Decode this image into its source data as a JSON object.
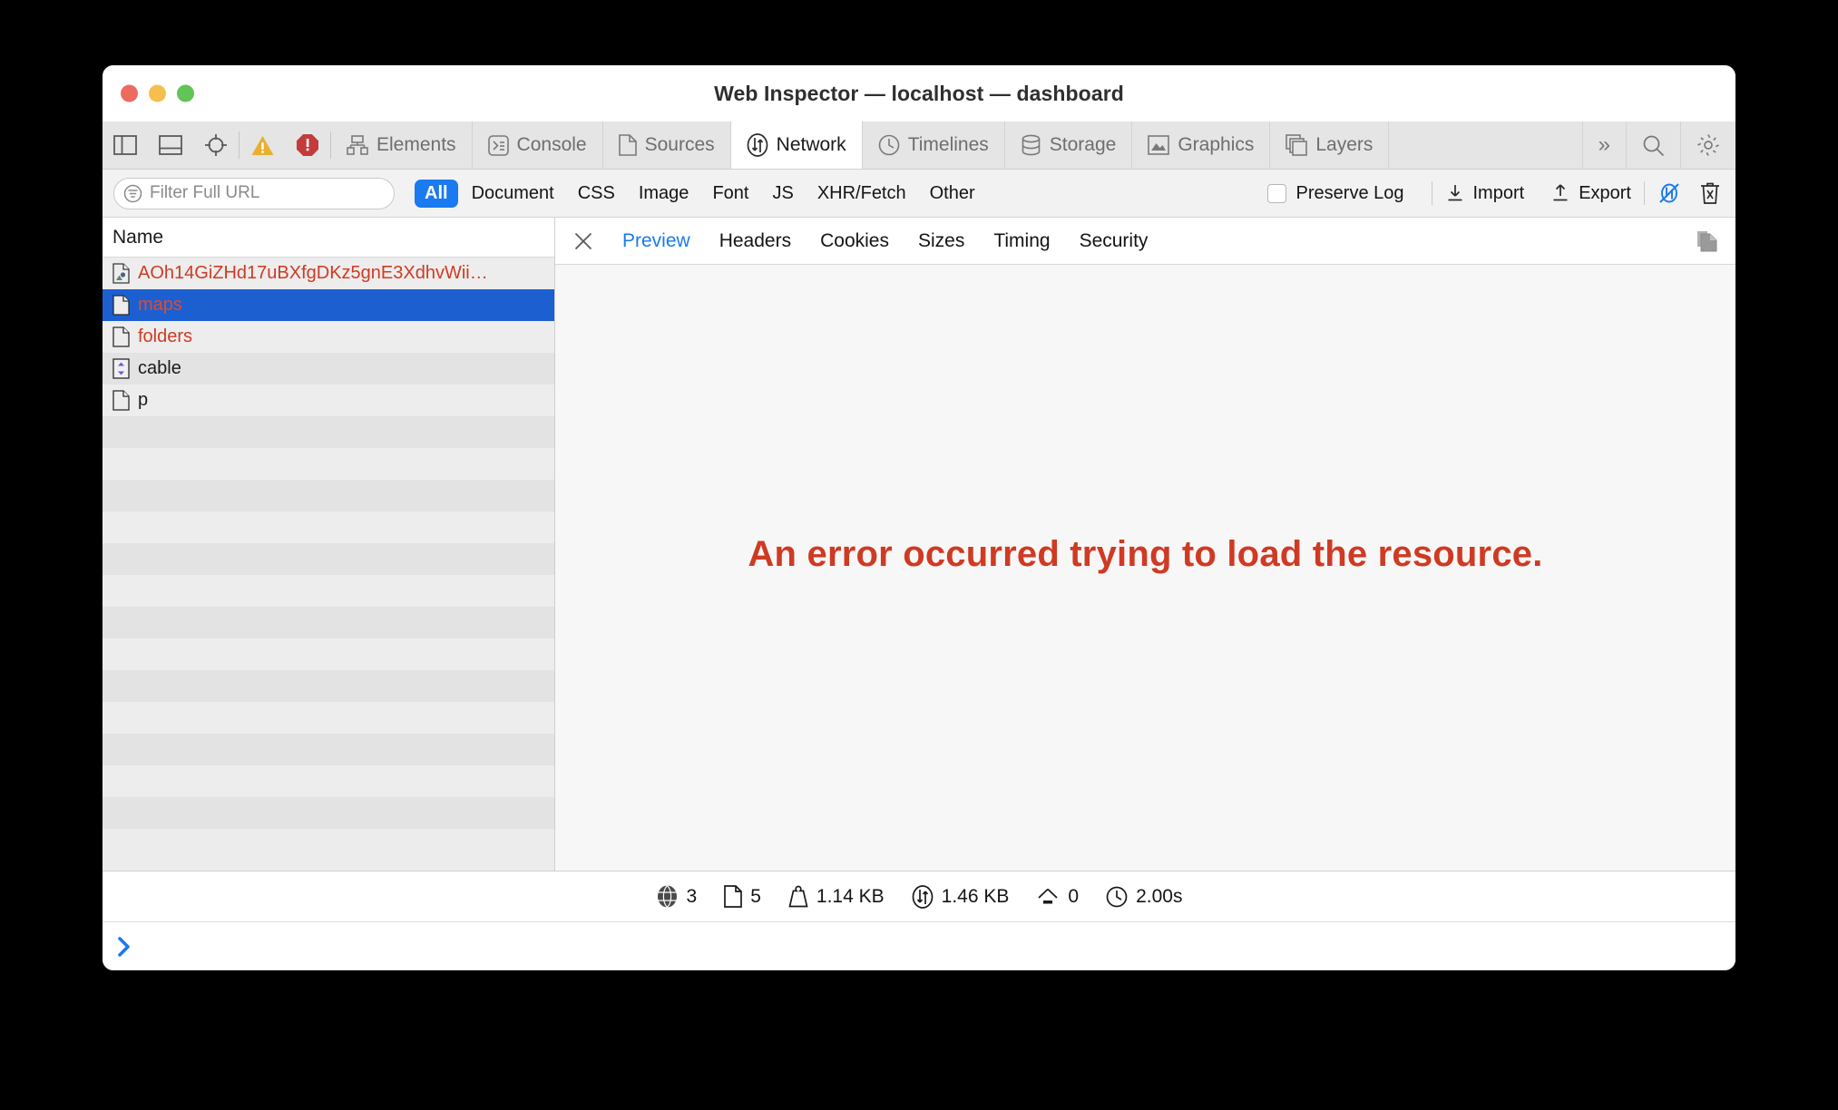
{
  "window": {
    "title": "Web Inspector — localhost — dashboard",
    "traffic_lights": [
      "close-red",
      "minimize-yellow",
      "zoom-green"
    ]
  },
  "toolbar": {
    "left_buttons": [
      {
        "name": "toggle-sidebar-left-icon",
        "label": ""
      },
      {
        "name": "toggle-sidebar-bottom-icon",
        "label": ""
      },
      {
        "name": "element-selector-icon",
        "label": ""
      }
    ],
    "badges": [
      {
        "name": "warning-badge-icon",
        "color": "#e8b02f"
      },
      {
        "name": "error-badge-icon",
        "color": "#c33c3c"
      }
    ],
    "tabs": [
      {
        "label": "Elements",
        "icon": "elements-icon",
        "active": false
      },
      {
        "label": "Console",
        "icon": "console-icon",
        "active": false
      },
      {
        "label": "Sources",
        "icon": "sources-icon",
        "active": false
      },
      {
        "label": "Network",
        "icon": "network-icon",
        "active": true
      },
      {
        "label": "Timelines",
        "icon": "timelines-icon",
        "active": false
      },
      {
        "label": "Storage",
        "icon": "storage-icon",
        "active": false
      },
      {
        "label": "Graphics",
        "icon": "graphics-icon",
        "active": false
      },
      {
        "label": "Layers",
        "icon": "layers-icon",
        "active": false
      }
    ],
    "overflow_label": "»",
    "search_icon": "search-icon",
    "settings_icon": "gear-icon"
  },
  "filter_bar": {
    "placeholder": "Filter Full URL",
    "value": "",
    "filter_icon": "filter-icon",
    "types": [
      {
        "label": "All",
        "selected": true
      },
      {
        "label": "Document",
        "selected": false
      },
      {
        "label": "CSS",
        "selected": false
      },
      {
        "label": "Image",
        "selected": false
      },
      {
        "label": "Font",
        "selected": false
      },
      {
        "label": "JS",
        "selected": false
      },
      {
        "label": "XHR/Fetch",
        "selected": false
      },
      {
        "label": "Other",
        "selected": false
      }
    ],
    "preserve_log": {
      "label": "Preserve Log",
      "checked": false
    },
    "import_label": "Import",
    "export_label": "Export",
    "accent_color": "#1a7aef"
  },
  "sidebar": {
    "column_header": "Name",
    "rows": [
      {
        "name": "AOh14GiZHd17uBXfgDKz5gnE3XdhvWii…",
        "icon": "image-file-icon",
        "error": true,
        "selected": false
      },
      {
        "name": "maps",
        "icon": "document-file-icon",
        "error": true,
        "selected": true
      },
      {
        "name": "folders",
        "icon": "document-file-icon",
        "error": true,
        "selected": false
      },
      {
        "name": "cable",
        "icon": "websocket-file-icon",
        "error": false,
        "selected": false
      },
      {
        "name": "p",
        "icon": "document-file-icon",
        "error": false,
        "selected": false
      }
    ],
    "empty_row_count": 13
  },
  "content": {
    "close_icon": "close-icon",
    "tabs": [
      {
        "label": "Preview",
        "active": true
      },
      {
        "label": "Headers",
        "active": false
      },
      {
        "label": "Cookies",
        "active": false
      },
      {
        "label": "Sizes",
        "active": false
      },
      {
        "label": "Timing",
        "active": false
      },
      {
        "label": "Security",
        "active": false
      }
    ],
    "copy_icon": "copy-icon",
    "error_message": "An error occurred trying to load the resource.",
    "error_color": "#cf3a23"
  },
  "status_bar": {
    "items": [
      {
        "icon": "globe-icon",
        "value": "3"
      },
      {
        "icon": "document-icon",
        "value": "5"
      },
      {
        "icon": "weight-icon",
        "value": "1.14 KB"
      },
      {
        "icon": "transfer-icon",
        "value": "1.46 KB"
      },
      {
        "icon": "load-icon",
        "value": "0"
      },
      {
        "icon": "clock-icon",
        "value": "2.00s"
      }
    ]
  },
  "console": {
    "prompt_icon": "chevron-right-icon",
    "prompt_color": "#1a7aef",
    "value": ""
  }
}
